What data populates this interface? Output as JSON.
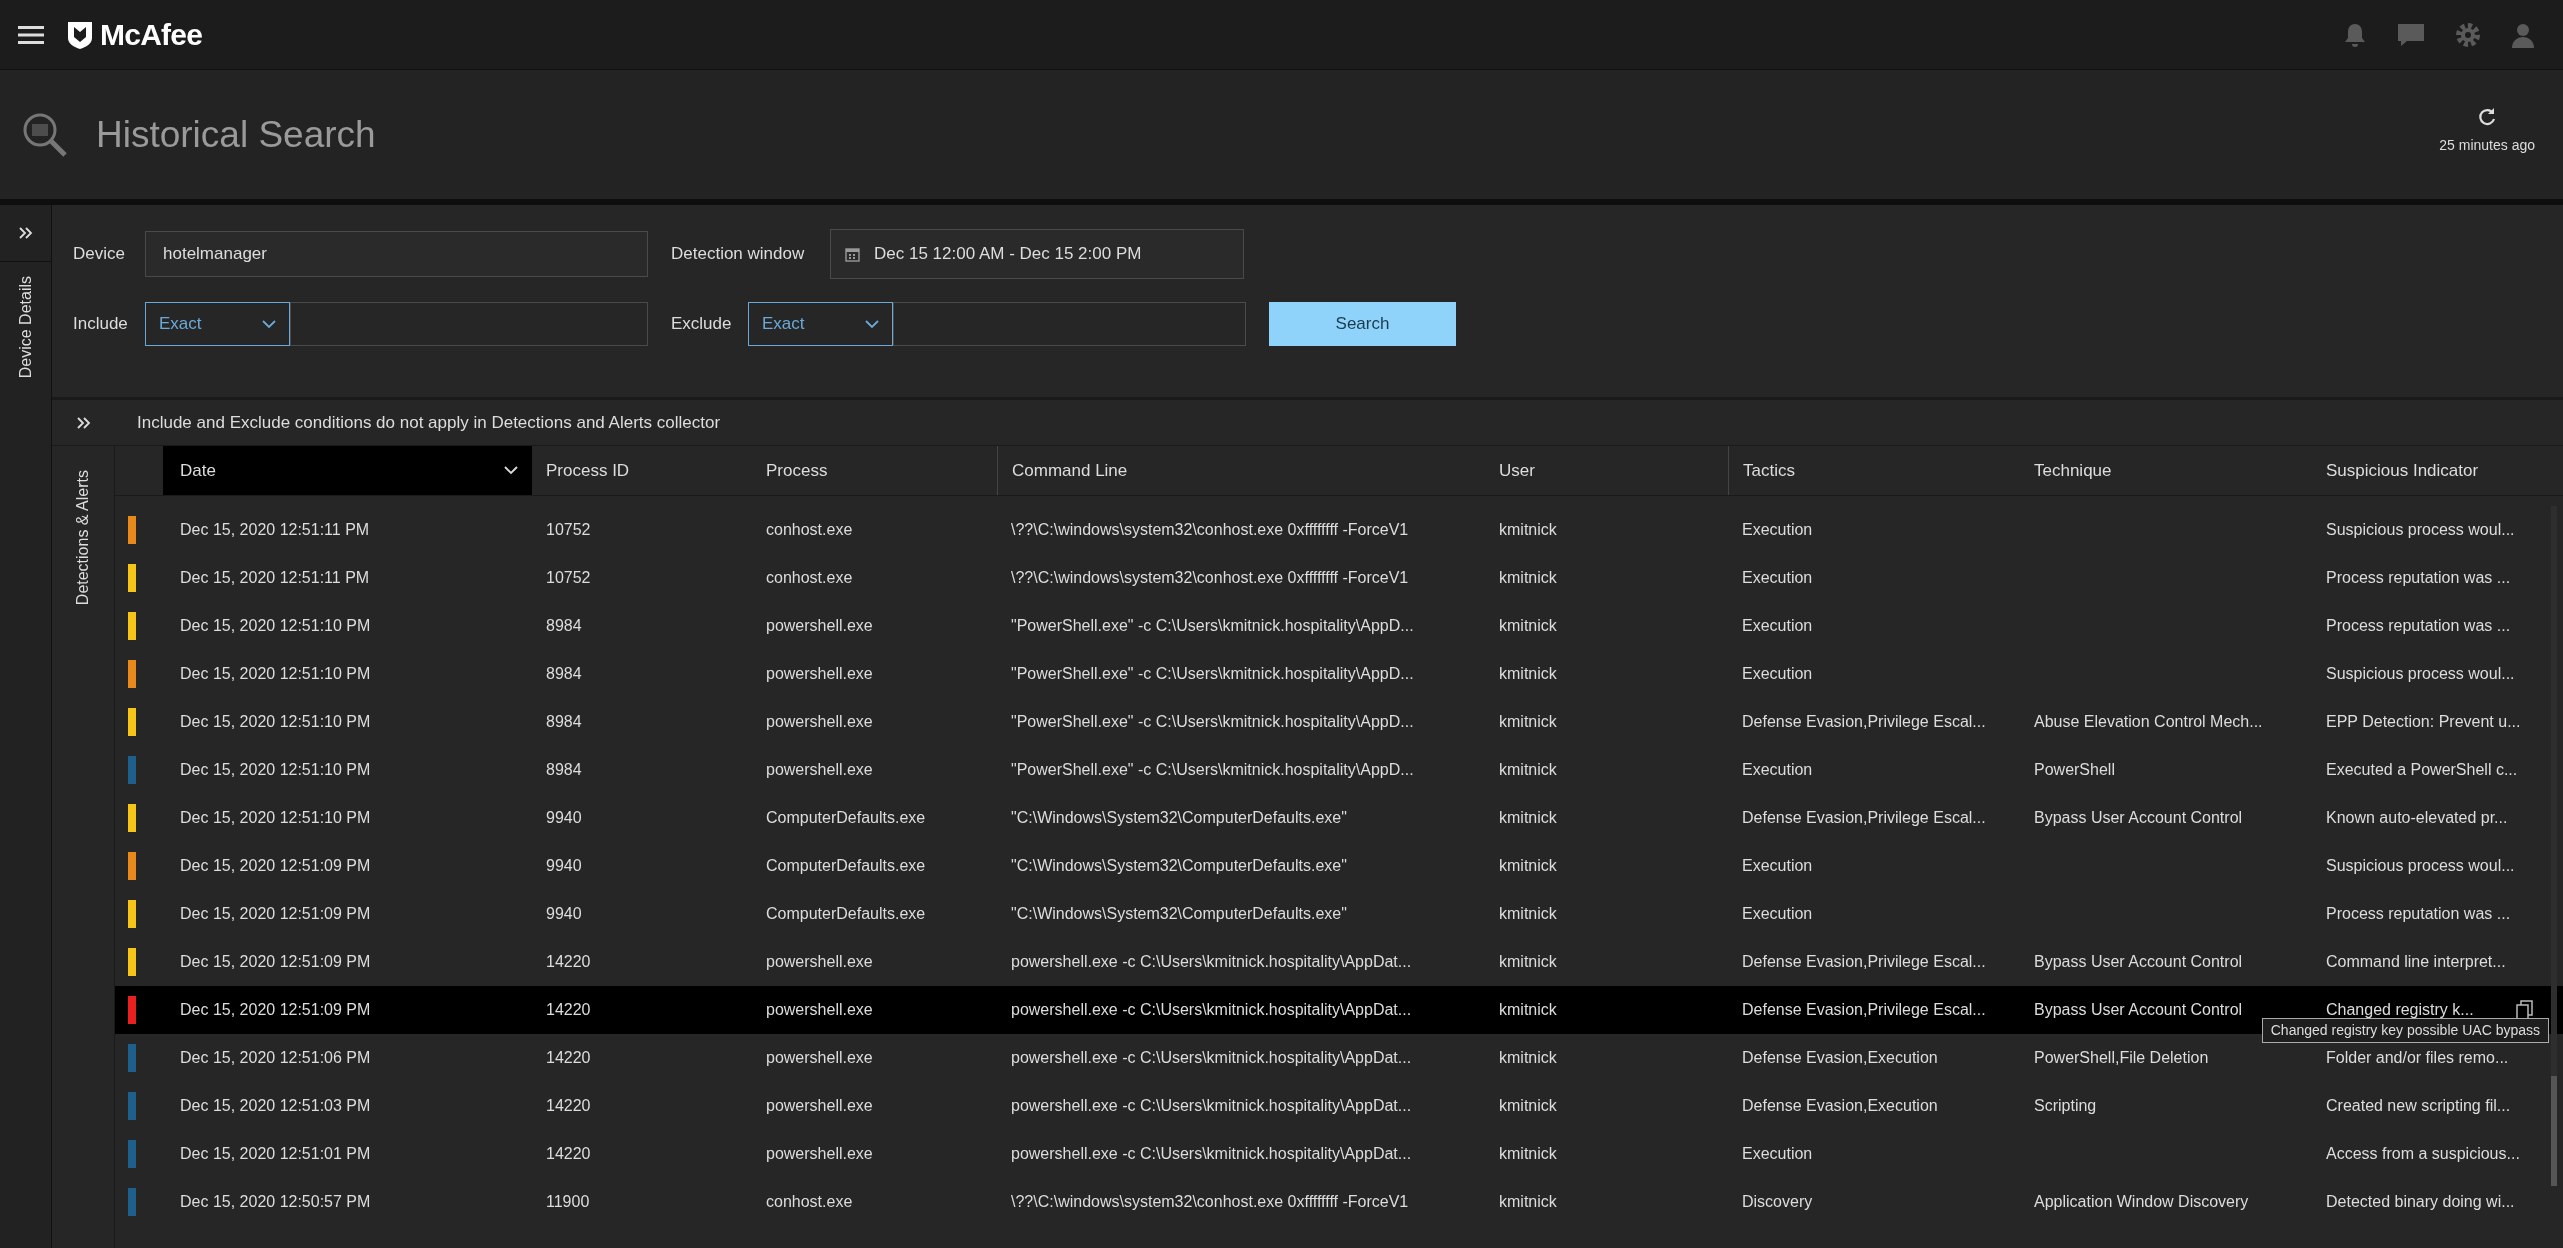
{
  "app": {
    "brand": "McAfee"
  },
  "page": {
    "title": "Historical Search",
    "refreshed": "25 minutes ago"
  },
  "side_tab": "Device Details",
  "filters": {
    "device_label": "Device",
    "device": "hotelmanager",
    "window_label": "Detection window",
    "window": "Dec 15 12:00 AM - Dec 15 2:00 PM",
    "include_label": "Include",
    "include_mode": "Exact",
    "exclude_label": "Exclude",
    "exclude_mode": "Exact",
    "search": "Search"
  },
  "notice": "Include and Exclude conditions do not apply in Detections and Alerts collector",
  "results_tab": "Detections & Alerts",
  "table": {
    "columns": [
      "Date",
      "Process ID",
      "Process",
      "Command Line",
      "User",
      "Tactics",
      "Technique",
      "Suspicious Indicator"
    ],
    "rows": [
      {
        "color": "#e8891c",
        "selected": false,
        "cells": [
          "Dec 15, 2020 12:51:11 PM",
          "10752",
          "conhost.exe",
          "\\??\\C:\\windows\\system32\\conhost.exe 0xffffffff -ForceV1",
          "kmitnick",
          "Execution",
          "",
          "Suspicious process woul..."
        ]
      },
      {
        "color": "#f5c518",
        "selected": false,
        "cells": [
          "Dec 15, 2020 12:51:11 PM",
          "10752",
          "conhost.exe",
          "\\??\\C:\\windows\\system32\\conhost.exe 0xffffffff -ForceV1",
          "kmitnick",
          "Execution",
          "",
          "Process reputation was ..."
        ]
      },
      {
        "color": "#f5c518",
        "selected": false,
        "cells": [
          "Dec 15, 2020 12:51:10 PM",
          "8984",
          "powershell.exe",
          "\"PowerShell.exe\" -c C:\\Users\\kmitnick.hospitality\\AppD...",
          "kmitnick",
          "Execution",
          "",
          "Process reputation was ..."
        ]
      },
      {
        "color": "#e8891c",
        "selected": false,
        "cells": [
          "Dec 15, 2020 12:51:10 PM",
          "8984",
          "powershell.exe",
          "\"PowerShell.exe\" -c C:\\Users\\kmitnick.hospitality\\AppD...",
          "kmitnick",
          "Execution",
          "",
          "Suspicious process woul..."
        ]
      },
      {
        "color": "#f5c518",
        "selected": false,
        "cells": [
          "Dec 15, 2020 12:51:10 PM",
          "8984",
          "powershell.exe",
          "\"PowerShell.exe\" -c C:\\Users\\kmitnick.hospitality\\AppD...",
          "kmitnick",
          "Defense Evasion,Privilege Escal...",
          "Abuse Elevation Control Mech...",
          "EPP Detection: Prevent u..."
        ]
      },
      {
        "color": "#1f5f8b",
        "selected": false,
        "cells": [
          "Dec 15, 2020 12:51:10 PM",
          "8984",
          "powershell.exe",
          "\"PowerShell.exe\" -c C:\\Users\\kmitnick.hospitality\\AppD...",
          "kmitnick",
          "Execution",
          "PowerShell",
          "Executed a PowerShell c..."
        ]
      },
      {
        "color": "#f5c518",
        "selected": false,
        "cells": [
          "Dec 15, 2020 12:51:10 PM",
          "9940",
          "ComputerDefaults.exe",
          "\"C:\\Windows\\System32\\ComputerDefaults.exe\"",
          "kmitnick",
          "Defense Evasion,Privilege Escal...",
          "Bypass User Account Control",
          "Known auto-elevated pr..."
        ]
      },
      {
        "color": "#e8891c",
        "selected": false,
        "cells": [
          "Dec 15, 2020 12:51:09 PM",
          "9940",
          "ComputerDefaults.exe",
          "\"C:\\Windows\\System32\\ComputerDefaults.exe\"",
          "kmitnick",
          "Execution",
          "",
          "Suspicious process woul..."
        ]
      },
      {
        "color": "#f5c518",
        "selected": false,
        "cells": [
          "Dec 15, 2020 12:51:09 PM",
          "9940",
          "ComputerDefaults.exe",
          "\"C:\\Windows\\System32\\ComputerDefaults.exe\"",
          "kmitnick",
          "Execution",
          "",
          "Process reputation was ..."
        ]
      },
      {
        "color": "#f5c518",
        "selected": false,
        "cells": [
          "Dec 15, 2020 12:51:09 PM",
          "14220",
          "powershell.exe",
          "powershell.exe -c C:\\Users\\kmitnick.hospitality\\AppDat...",
          "kmitnick",
          "Defense Evasion,Privilege Escal...",
          "Bypass User Account Control",
          "Command line interpret..."
        ]
      },
      {
        "color": "#e8201f",
        "selected": true,
        "tooltip": "Changed registry key possible UAC bypass",
        "cells": [
          "Dec 15, 2020 12:51:09 PM",
          "14220",
          "powershell.exe",
          "powershell.exe -c C:\\Users\\kmitnick.hospitality\\AppDat...",
          "kmitnick",
          "Defense Evasion,Privilege Escal...",
          "Bypass User Account Control",
          "Changed registry k..."
        ]
      },
      {
        "color": "#1f5f8b",
        "selected": false,
        "cells": [
          "Dec 15, 2020 12:51:06 PM",
          "14220",
          "powershell.exe",
          "powershell.exe -c C:\\Users\\kmitnick.hospitality\\AppDat...",
          "kmitnick",
          "Defense Evasion,Execution",
          "PowerShell,File Deletion",
          "Folder and/or files remo..."
        ]
      },
      {
        "color": "#1f5f8b",
        "selected": false,
        "cells": [
          "Dec 15, 2020 12:51:03 PM",
          "14220",
          "powershell.exe",
          "powershell.exe -c C:\\Users\\kmitnick.hospitality\\AppDat...",
          "kmitnick",
          "Defense Evasion,Execution",
          "Scripting",
          "Created new scripting fil..."
        ]
      },
      {
        "color": "#1f5f8b",
        "selected": false,
        "cells": [
          "Dec 15, 2020 12:51:01 PM",
          "14220",
          "powershell.exe",
          "powershell.exe -c C:\\Users\\kmitnick.hospitality\\AppDat...",
          "kmitnick",
          "Execution",
          "",
          "Access from a suspicious..."
        ]
      },
      {
        "color": "#1f5f8b",
        "selected": false,
        "cells": [
          "Dec 15, 2020 12:50:57 PM",
          "11900",
          "conhost.exe",
          "\\??\\C:\\windows\\system32\\conhost.exe 0xffffffff -ForceV1",
          "kmitnick",
          "Discovery",
          "Application Window Discovery",
          "Detected binary doing wi..."
        ]
      }
    ]
  }
}
